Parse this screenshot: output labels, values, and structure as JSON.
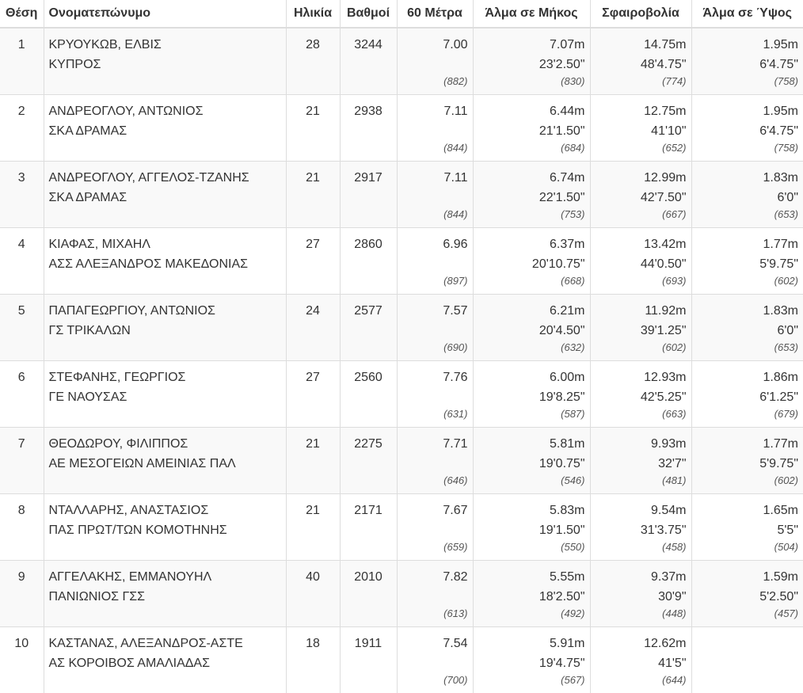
{
  "headers": {
    "position": "Θέση",
    "name": "Ονοματεπώνυμο",
    "age": "Ηλικία",
    "points": "Βαθμοί",
    "sixty": "60 Μέτρα",
    "long_jump": "Άλμα σε Μήκος",
    "shot_put": "Σφαιροβολία",
    "high_jump": "Άλμα σε Ύψος"
  },
  "rows": [
    {
      "pos": "1",
      "name": "ΚΡΥΟΥΚΩΒ, ΕΛΒΙΣ",
      "club": "ΚΥΠΡΟΣ",
      "age": "28",
      "points": "3244",
      "e60": {
        "mark": "7.00",
        "score": "(882)"
      },
      "lj": {
        "m": "7.07m",
        "imp": "23'2.50\"",
        "score": "(830)"
      },
      "sp": {
        "m": "14.75m",
        "imp": "48'4.75\"",
        "score": "(774)"
      },
      "hj": {
        "m": "1.95m",
        "imp": "6'4.75\"",
        "score": "(758)"
      }
    },
    {
      "pos": "2",
      "name": "ΑΝΔΡΕΟΓΛΟΥ, ΑΝΤΩΝΙΟΣ",
      "club": "ΣΚΑ ΔΡΑΜΑΣ",
      "age": "21",
      "points": "2938",
      "e60": {
        "mark": "7.11",
        "score": "(844)"
      },
      "lj": {
        "m": "6.44m",
        "imp": "21'1.50\"",
        "score": "(684)"
      },
      "sp": {
        "m": "12.75m",
        "imp": "41'10\"",
        "score": "(652)"
      },
      "hj": {
        "m": "1.95m",
        "imp": "6'4.75\"",
        "score": "(758)"
      }
    },
    {
      "pos": "3",
      "name": "ΑΝΔΡΕΟΓΛΟΥ, ΑΓΓΕΛΟΣ-ΤΖΑΝΗΣ",
      "club": "ΣΚΑ ΔΡΑΜΑΣ",
      "age": "21",
      "points": "2917",
      "e60": {
        "mark": "7.11",
        "score": "(844)"
      },
      "lj": {
        "m": "6.74m",
        "imp": "22'1.50\"",
        "score": "(753)"
      },
      "sp": {
        "m": "12.99m",
        "imp": "42'7.50\"",
        "score": "(667)"
      },
      "hj": {
        "m": "1.83m",
        "imp": "6'0\"",
        "score": "(653)"
      }
    },
    {
      "pos": "4",
      "name": "ΚΙΑΦΑΣ, ΜΙΧΑΗΛ",
      "club": "ΑΣΣ ΑΛΕΞΑΝΔΡΟΣ ΜΑΚΕΔΟΝΙΑΣ",
      "age": "27",
      "points": "2860",
      "e60": {
        "mark": "6.96",
        "score": "(897)"
      },
      "lj": {
        "m": "6.37m",
        "imp": "20'10.75\"",
        "score": "(668)"
      },
      "sp": {
        "m": "13.42m",
        "imp": "44'0.50\"",
        "score": "(693)"
      },
      "hj": {
        "m": "1.77m",
        "imp": "5'9.75\"",
        "score": "(602)"
      }
    },
    {
      "pos": "5",
      "name": "ΠΑΠΑΓΕΩΡΓΙΟΥ, ΑΝΤΩΝΙΟΣ",
      "club": "ΓΣ ΤΡΙΚΑΛΩΝ",
      "age": "24",
      "points": "2577",
      "e60": {
        "mark": "7.57",
        "score": "(690)"
      },
      "lj": {
        "m": "6.21m",
        "imp": "20'4.50\"",
        "score": "(632)"
      },
      "sp": {
        "m": "11.92m",
        "imp": "39'1.25\"",
        "score": "(602)"
      },
      "hj": {
        "m": "1.83m",
        "imp": "6'0\"",
        "score": "(653)"
      }
    },
    {
      "pos": "6",
      "name": "ΣΤΕΦΑΝΗΣ, ΓΕΩΡΓΙΟΣ",
      "club": "ΓΕ ΝΑΟΥΣΑΣ",
      "age": "27",
      "points": "2560",
      "e60": {
        "mark": "7.76",
        "score": "(631)"
      },
      "lj": {
        "m": "6.00m",
        "imp": "19'8.25\"",
        "score": "(587)"
      },
      "sp": {
        "m": "12.93m",
        "imp": "42'5.25\"",
        "score": "(663)"
      },
      "hj": {
        "m": "1.86m",
        "imp": "6'1.25\"",
        "score": "(679)"
      }
    },
    {
      "pos": "7",
      "name": "ΘΕΟΔΩΡΟΥ, ΦΙΛΙΠΠΟΣ",
      "club": "ΑΕ ΜΕΣΟΓΕΙΩΝ ΑΜΕΙΝΙΑΣ ΠΑΛ",
      "age": "21",
      "points": "2275",
      "e60": {
        "mark": "7.71",
        "score": "(646)"
      },
      "lj": {
        "m": "5.81m",
        "imp": "19'0.75\"",
        "score": "(546)"
      },
      "sp": {
        "m": "9.93m",
        "imp": "32'7\"",
        "score": "(481)"
      },
      "hj": {
        "m": "1.77m",
        "imp": "5'9.75\"",
        "score": "(602)"
      }
    },
    {
      "pos": "8",
      "name": "ΝΤΑΛΛΑΡΗΣ, ΑΝΑΣΤΑΣΙΟΣ",
      "club": "ΠΑΣ ΠΡΩΤ/ΤΩΝ ΚΟΜΟΤΗΝΗΣ",
      "age": "21",
      "points": "2171",
      "e60": {
        "mark": "7.67",
        "score": "(659)"
      },
      "lj": {
        "m": "5.83m",
        "imp": "19'1.50\"",
        "score": "(550)"
      },
      "sp": {
        "m": "9.54m",
        "imp": "31'3.75\"",
        "score": "(458)"
      },
      "hj": {
        "m": "1.65m",
        "imp": "5'5\"",
        "score": "(504)"
      }
    },
    {
      "pos": "9",
      "name": "ΑΓΓΕΛΑΚΗΣ, ΕΜΜΑΝΟΥΗΛ",
      "club": "ΠΑΝΙΩΝΙΟΣ ΓΣΣ",
      "age": "40",
      "points": "2010",
      "e60": {
        "mark": "7.82",
        "score": "(613)"
      },
      "lj": {
        "m": "5.55m",
        "imp": "18'2.50\"",
        "score": "(492)"
      },
      "sp": {
        "m": "9.37m",
        "imp": "30'9\"",
        "score": "(448)"
      },
      "hj": {
        "m": "1.59m",
        "imp": "5'2.50\"",
        "score": "(457)"
      }
    },
    {
      "pos": "10",
      "name": "ΚΑΣΤΑΝΑΣ, ΑΛΕΞΑΝΔΡΟΣ-ΑΣΤΕ",
      "club": "ΑΣ ΚΟΡΟΙΒΟΣ ΑΜΑΛΙΑΔΑΣ",
      "age": "18",
      "points": "1911",
      "e60": {
        "mark": "7.54",
        "score": "(700)"
      },
      "lj": {
        "m": "5.91m",
        "imp": "19'4.75\"",
        "score": "(567)"
      },
      "sp": {
        "m": "12.62m",
        "imp": "41'5\"",
        "score": "(644)"
      },
      "hj": {
        "m": "",
        "imp": "",
        "score": ""
      }
    }
  ]
}
